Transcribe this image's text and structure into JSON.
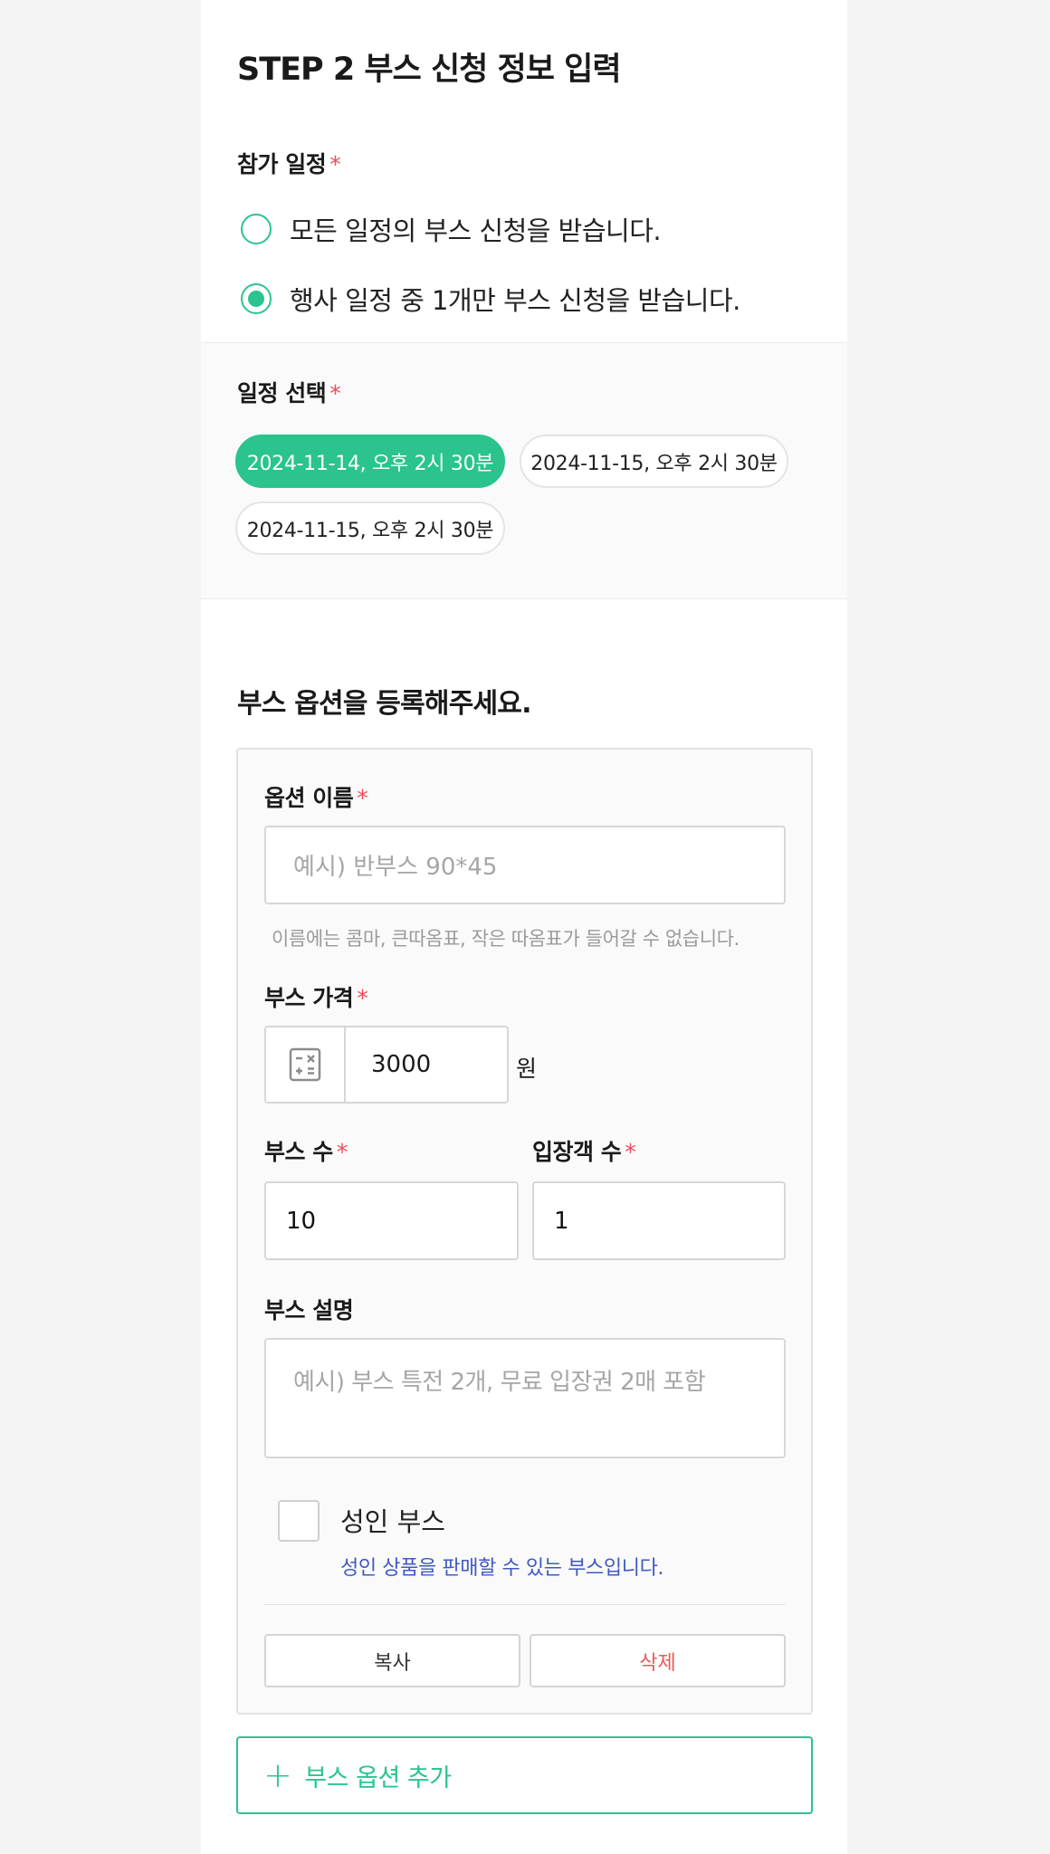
{
  "step_title": "STEP 2 부스 신청 정보 입력",
  "schedule": {
    "label": "참가 일정",
    "required": "*",
    "options": [
      {
        "label": "모든 일정의 부스 신청을 받습니다.",
        "selected": false
      },
      {
        "label": "행사 일정 중 1개만 부스 신청을 받습니다.",
        "selected": true
      }
    ]
  },
  "date_select": {
    "label": "일정 선택",
    "required": "*",
    "chips": [
      {
        "label": "2024-11-14, 오후 2시 30분",
        "selected": true
      },
      {
        "label": "2024-11-15, 오후 2시 30분",
        "selected": false
      },
      {
        "label": "2024-11-15, 오후 2시 30분",
        "selected": false
      }
    ]
  },
  "booth_option": {
    "heading": "부스 옵션을 등록해주세요.",
    "name_label": "옵션 이름",
    "name_placeholder": "예시) 반부스 90*45",
    "name_help": "이름에는 콤마, 큰따옴표, 작은 따옴표가 들어갈 수 없습니다.",
    "price_label": "부스 가격",
    "price_value": "3000",
    "price_unit": "원",
    "count_label": "부스 수",
    "count_value": "10",
    "visitors_label": "입장객 수",
    "visitors_value": "1",
    "desc_label": "부스 설명",
    "desc_placeholder": "예시) 부스 특전 2개, 무료 입장권 2매 포함",
    "adult_label": "성인 부스",
    "adult_desc": "성인 상품을 판매할 수 있는 부스입니다.",
    "adult_checked": false,
    "copy_label": "복사",
    "delete_label": "삭제",
    "required": "*"
  },
  "add_option_label": "부스 옵션 추가",
  "colors": {
    "accent": "#2ac48c",
    "required": "#ef4b5b",
    "info": "#3f5ac0",
    "danger": "#ea5a5a"
  }
}
